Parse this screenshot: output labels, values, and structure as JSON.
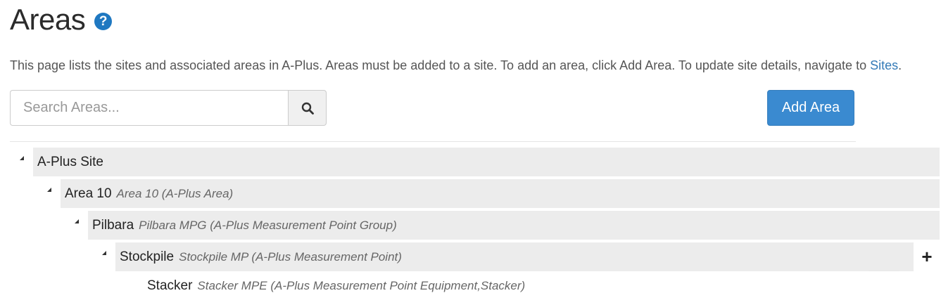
{
  "header": {
    "title": "Areas",
    "help_icon": "question-circle-icon",
    "help_glyph": "?"
  },
  "description": {
    "text": "This page lists the sites and associated areas in A-Plus. Areas must be added to a site. To add an area, click Add Area. To update site details, navigate to ",
    "link_text": "Sites",
    "trailing": "."
  },
  "search": {
    "placeholder": "Search Areas...",
    "value": "",
    "icon": "search-icon"
  },
  "toolbar": {
    "add_area_label": "Add Area"
  },
  "tree": {
    "site": {
      "name": "A-Plus Site",
      "expanded": true
    },
    "area": {
      "name": "Area 10",
      "description": "Area 10 (A-Plus Area)",
      "expanded": true
    },
    "group": {
      "name": "Pilbara",
      "description": "Pilbara MPG (A-Plus Measurement Point Group)",
      "expanded": true
    },
    "point": {
      "name": "Stockpile",
      "description": "Stockpile MP (A-Plus Measurement Point)",
      "expanded": true
    },
    "equipment": {
      "name": "Stacker",
      "description": "Stacker MPE (A-Plus Measurement Point Equipment,Stacker)"
    },
    "add_glyph": "+"
  },
  "colors": {
    "accent": "#3a8ad0",
    "link": "#337ab7",
    "help_icon": "#1f78c1",
    "row_background": "#ececec"
  }
}
